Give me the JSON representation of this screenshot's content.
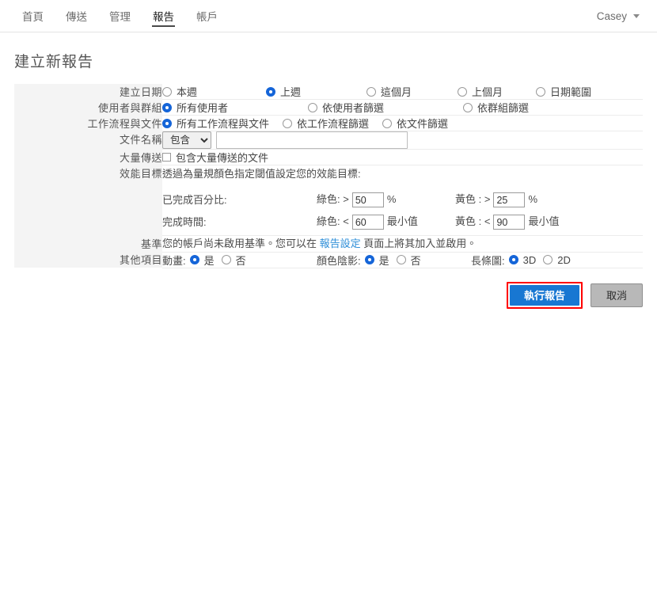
{
  "nav": {
    "items": [
      {
        "label": "首頁",
        "active": false
      },
      {
        "label": "傳送",
        "active": false
      },
      {
        "label": "管理",
        "active": false
      },
      {
        "label": "報告",
        "active": true
      },
      {
        "label": "帳戶",
        "active": false
      }
    ],
    "user": "Casey",
    "caret_icon": "chevron-down-icon"
  },
  "page": {
    "title": "建立新報告"
  },
  "rows": {
    "created_date": {
      "label": "建立日期",
      "options": [
        "本週",
        "上週",
        "這個月",
        "上個月",
        "日期範圍"
      ],
      "selected": "上週"
    },
    "users_groups": {
      "label": "使用者與群組",
      "options": [
        "所有使用者",
        "依使用者篩選",
        "依群組篩選"
      ],
      "selected": "所有使用者"
    },
    "workflows_docs": {
      "label": "工作流程與文件",
      "options": [
        "所有工作流程與文件",
        "依工作流程篩選",
        "依文件篩選"
      ],
      "selected": "所有工作流程與文件"
    },
    "doc_name": {
      "label": "文件名稱",
      "operator_selected": "包含",
      "operator_options": [
        "包含"
      ],
      "value": "",
      "placeholder": ""
    },
    "mega_sign": {
      "label": "大量傳送",
      "checkbox_label": "包含大量傳送的文件",
      "checked": false
    },
    "performance": {
      "label": "效能目標",
      "description": "透過為量規顏色指定閾值設定您的效能目標:",
      "completed_pct": {
        "row_label": "已完成百分比:",
        "green_label": "綠色: >",
        "green_value": "50",
        "green_unit": "%",
        "yellow_label": "黃色 : >",
        "yellow_value": "25",
        "yellow_unit": "%"
      },
      "completion_time": {
        "row_label": "完成時間:",
        "green_label": "綠色: <",
        "green_value": "60",
        "green_unit": "最小值",
        "yellow_label": "黃色 : <",
        "yellow_value": "90",
        "yellow_unit": "最小值"
      }
    },
    "baseline": {
      "label": "基準",
      "text_before": "您的帳戶尚未啟用基準。您可以在",
      "link_text": "報告設定",
      "text_after": "頁面上將其加入並啟用。"
    },
    "other": {
      "label": "其他項目",
      "animation": {
        "group_label": "動畫:",
        "options": [
          "是",
          "否"
        ],
        "selected": "是"
      },
      "color_shading": {
        "group_label": "顏色陰影:",
        "options": [
          "是",
          "否"
        ],
        "selected": "是"
      },
      "bar_chart": {
        "group_label": "長條圖:",
        "options": [
          "3D",
          "2D"
        ],
        "selected": "3D"
      }
    }
  },
  "actions": {
    "run_label": "執行報告",
    "cancel_label": "取消",
    "highlight_color": "#ff0000",
    "primary_color": "#1877d2"
  }
}
